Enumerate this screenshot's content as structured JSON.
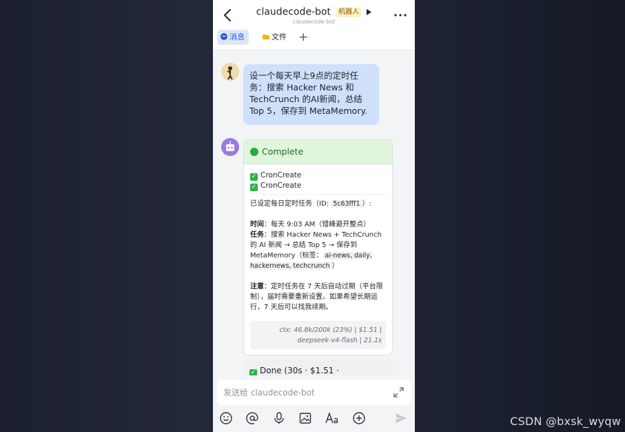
{
  "header": {
    "title": "claudecode-bot",
    "badge": "机器人",
    "subtitle": "claudecode-bot"
  },
  "tabs": [
    {
      "label": "消息"
    },
    {
      "label": "文件"
    },
    {
      "label": "+"
    }
  ],
  "user_message": {
    "text": "设一个每天早上9点的定时任务：搜索 Hacker News 和TechCrunch 的AI新闻，总结 Top 5，保存到 MetaMemory."
  },
  "bot_card": {
    "status": "Complete",
    "tools": [
      "CronCreate",
      "CronCreate"
    ],
    "intro_prefix": "已设定每日定时任务（ID: ",
    "task_id": "5c63fff1",
    "intro_suffix": "）:",
    "time_label": "时间",
    "time_value": "：每天 9:03 AM（错峰避开整点）",
    "task_label": "任务",
    "task_value": "：搜索 Hacker News + TechCrunch 的 AI 新闻 → 总结 Top 5 → 保存到 MetaMemory（标签：",
    "tags": "ai-news, daily, hackernews, techcrunch",
    "task_end": "）",
    "note_label": "注意",
    "note_value": "：定时任务在 7 天后自动过期（平台限制），届时需要重新设置。如果希望长期运行，7 天后可以找我续期。",
    "meta_line1": "ctx: 46.8k/200k (23%) | $1.51 |",
    "meta_line2": "deepseek-v4-flash | 21.1s"
  },
  "done_card": {
    "text": "Done (30s · $1.51 ·"
  },
  "input": {
    "placeholder": "发送给 claudecode-bot"
  },
  "toolbar_icons": [
    "emoji-icon",
    "mention-icon",
    "mic-icon",
    "image-icon",
    "text-format-icon",
    "add-icon",
    "send-icon"
  ],
  "watermark": "CSDN @bxsk_wyqw"
}
